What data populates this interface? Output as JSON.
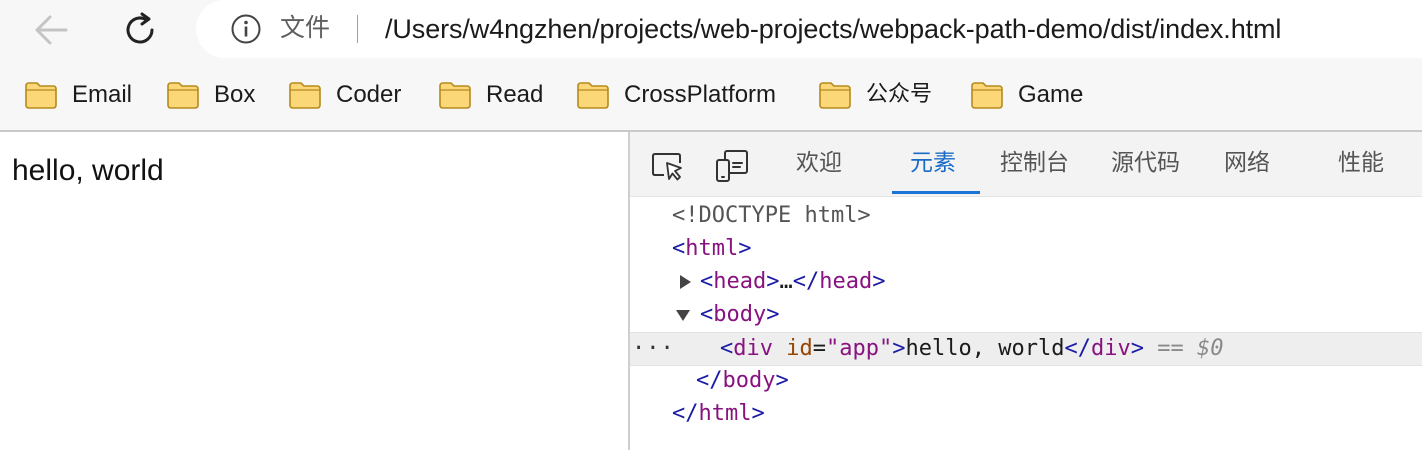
{
  "address_bar": {
    "file_label": "文件",
    "url": "/Users/w4ngzhen/projects/web-projects/webpack-path-demo/dist/index.html"
  },
  "bookmarks": [
    {
      "label": "Email",
      "icon": "folder-icon"
    },
    {
      "label": "Box",
      "icon": "folder-icon"
    },
    {
      "label": "Coder",
      "icon": "folder-icon"
    },
    {
      "label": "Read",
      "icon": "folder-icon"
    },
    {
      "label": "CrossPlatform",
      "icon": "folder-icon"
    },
    {
      "label": "公众号",
      "icon": "folder-icon"
    },
    {
      "label": "Game",
      "icon": "folder-icon"
    }
  ],
  "page": {
    "content": "hello, world"
  },
  "devtools": {
    "tabs": [
      {
        "label": "欢迎",
        "active": false
      },
      {
        "label": "元素",
        "active": true
      },
      {
        "label": "控制台",
        "active": false
      },
      {
        "label": "源代码",
        "active": false
      },
      {
        "label": "网络",
        "active": false
      },
      {
        "label": "性能",
        "active": false
      }
    ],
    "dom": {
      "doctype": "<!DOCTYPE html>",
      "html_tag": "html",
      "head_tag": "head",
      "head_ellipsis": "…",
      "body_tag": "body",
      "div_tag": "div",
      "div_attr_name": "id",
      "div_attr_value": "app",
      "div_text": "hello, world",
      "selected_marker": "== $0",
      "row_menu": "···"
    },
    "accent_color": "#1a73d6"
  },
  "colors": {
    "toolbar_bg": "#f7f7f7",
    "folder_fill": "#fcd777",
    "folder_stroke": "#b58a1e"
  }
}
